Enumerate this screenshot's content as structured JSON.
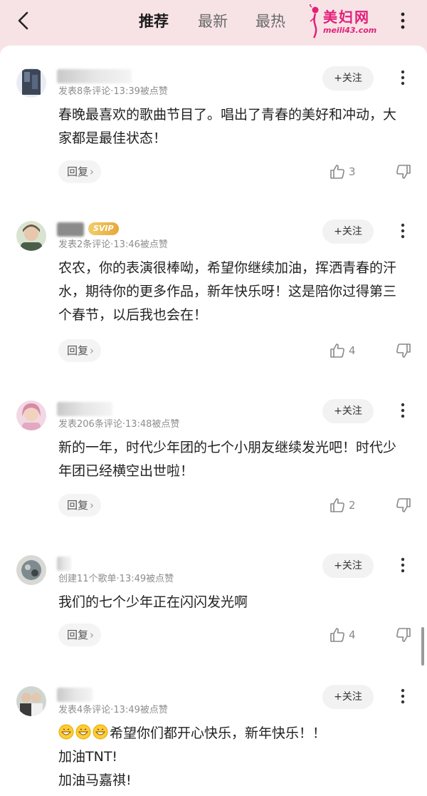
{
  "tabs": [
    {
      "label": "推荐",
      "active": true
    },
    {
      "label": "最新",
      "active": false
    },
    {
      "label": "最热",
      "active": false
    }
  ],
  "watermark": {
    "title": "美妇网",
    "url": "meili43.com"
  },
  "follow_label": "+关注",
  "reply_label": "回复",
  "comments": [
    {
      "meta": "发表8条评论·13:39被点赞",
      "text": "春晚最喜欢的歌曲节目了。唱出了青春的美好和冲动，大家都是最佳状态！",
      "likes": "3",
      "vip": ""
    },
    {
      "meta": "发表2条评论·13:46被点赞",
      "text": "农农，你的表演很棒呦，希望你继续加油，挥洒青春的汗水，期待你的更多作品，新年快乐呀！这是陪你过得第三个春节，以后我也会在！",
      "likes": "4",
      "vip": "SVIP"
    },
    {
      "meta": "发表206条评论·13:48被点赞",
      "text": "新的一年，时代少年团的七个小朋友继续发光吧！时代少年团已经横空出世啦！",
      "likes": "2",
      "vip": ""
    },
    {
      "meta": "创建11个歌单·13:49被点赞",
      "text": "我们的七个少年正在闪闪发光啊",
      "likes": "4",
      "vip": ""
    },
    {
      "meta": "发表4条评论·13:49被点赞",
      "text_line1": "希望你们都开心快乐，新年快乐！！",
      "text_line2": "加油TNT!",
      "text_line3": "加油马嘉祺!",
      "likes": "",
      "vip": ""
    }
  ],
  "colors": {
    "accent": "#e2207a",
    "header_bg": "#f7e3e6"
  },
  "icons": [
    "back-icon",
    "more-icon",
    "like-icon",
    "dislike-icon",
    "grin-emoji-icon"
  ]
}
